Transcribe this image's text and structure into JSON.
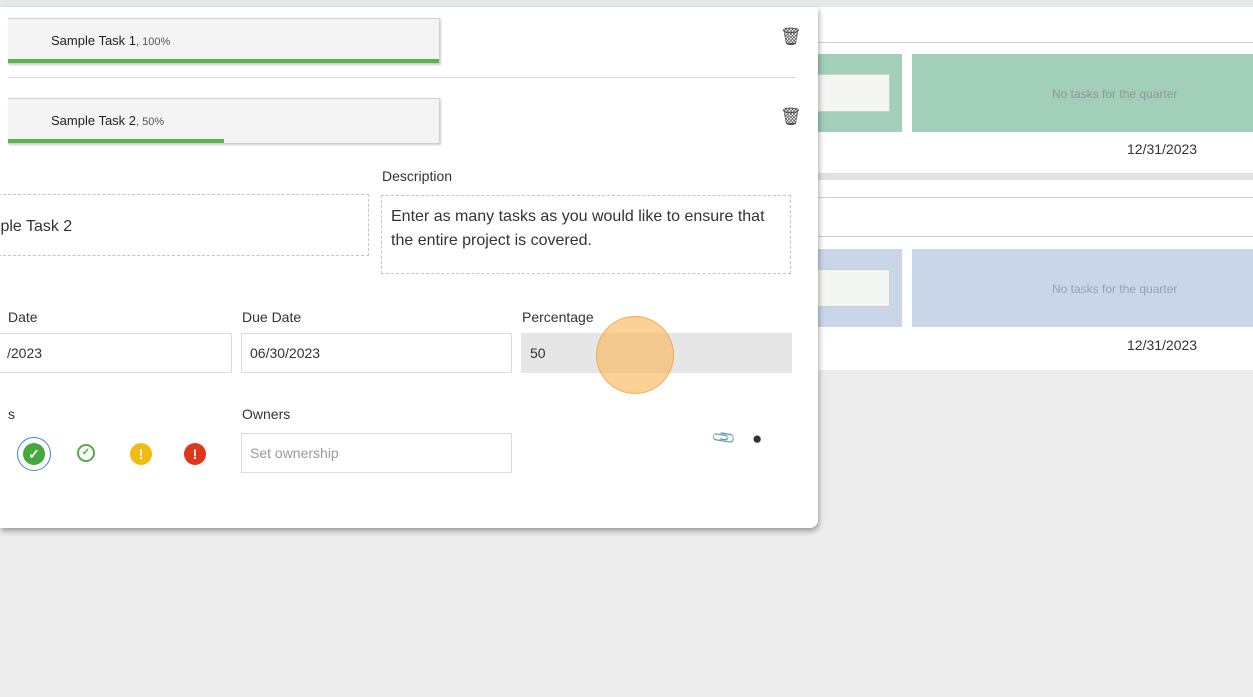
{
  "tasks": [
    {
      "name": "Sample Task 1",
      "percent_label": ", 100%",
      "progress": 1.0
    },
    {
      "name": "Sample Task 2",
      "percent_label": ", 50%",
      "progress": 0.5
    }
  ],
  "form": {
    "name_value": "ıple Task 2",
    "description_label": "Description",
    "description_value": "Enter as many tasks as you would like to ensure that the entire project is covered.",
    "start_date_label": "Date",
    "start_date_value": "/2023",
    "due_date_label": "Due Date",
    "due_date_value": "06/30/2023",
    "percentage_label": "Percentage",
    "percentage_value": "50",
    "status_label": "s",
    "owners_label": "Owners",
    "owners_placeholder": "Set ownership"
  },
  "board": {
    "row1": {
      "empty_text": "No tasks for the quarter",
      "date": "12/31/2023",
      "color": "#a1cfb8"
    },
    "row2": {
      "empty_text": "No tasks for the quarter",
      "date": "12/31/2023",
      "color": "#c9d6ea"
    }
  },
  "icons": {
    "trash": "trash-icon",
    "paperclip": "paperclip-icon",
    "comment": "comment-icon",
    "status": [
      "status-complete-icon",
      "status-on-track-icon",
      "status-warning-icon",
      "status-critical-icon"
    ]
  },
  "colors": {
    "progress": "#56b848",
    "status_green": "#43a93c",
    "status_yellow": "#f2bb10",
    "status_red": "#e2351e"
  }
}
